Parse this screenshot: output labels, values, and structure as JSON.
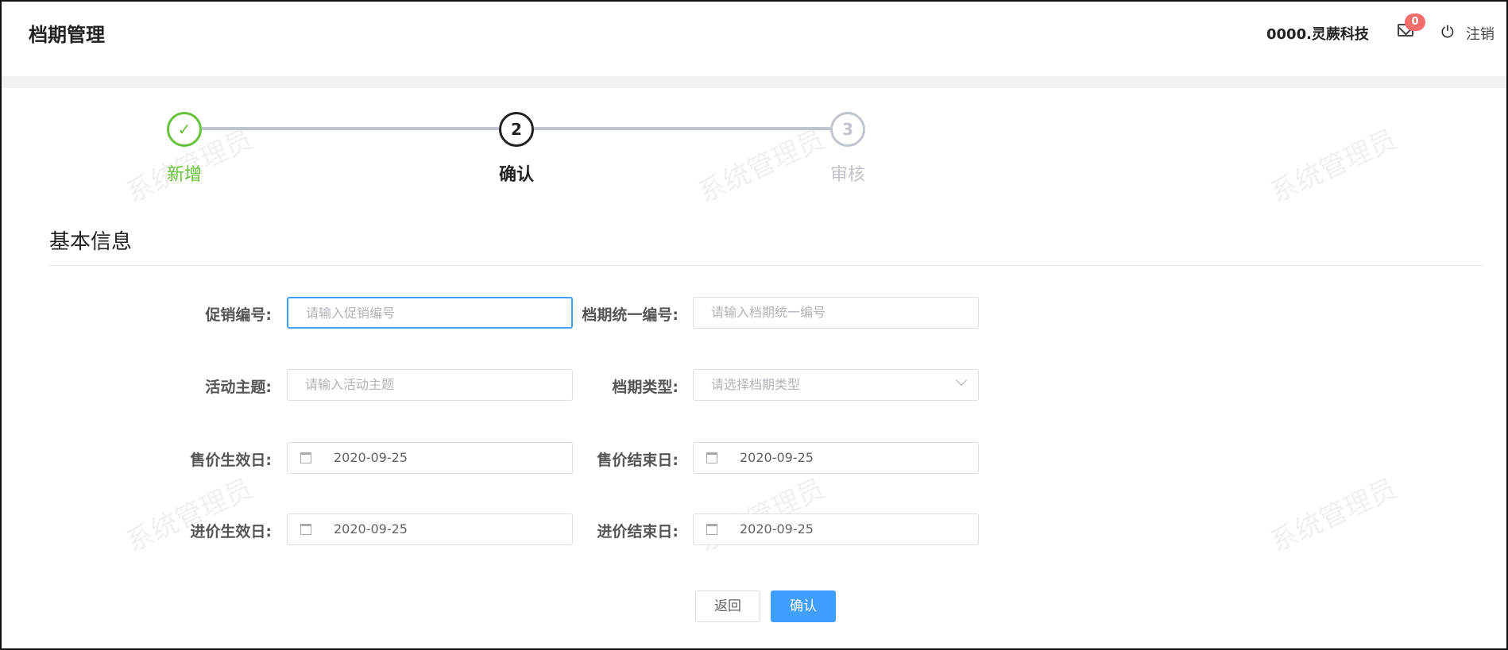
{
  "header": {
    "title": "档期管理",
    "company": "0000.灵蕨科技",
    "mail_count": "0",
    "logout": "注销"
  },
  "steps": [
    {
      "num": "1",
      "label": "新增",
      "status": "done"
    },
    {
      "num": "2",
      "label": "确认",
      "status": "active"
    },
    {
      "num": "3",
      "label": "审核",
      "status": "wait"
    }
  ],
  "section_title": "基本信息",
  "form": {
    "promo_no": {
      "label": "促销编号:",
      "placeholder": "请输入促销编号"
    },
    "schedule_no": {
      "label": "档期统一编号:",
      "placeholder": "请输入档期统一编号"
    },
    "theme": {
      "label": "活动主题:",
      "placeholder": "请输入活动主题"
    },
    "schedule_type": {
      "label": "档期类型:",
      "placeholder": "请选择档期类型"
    },
    "sale_start": {
      "label": "售价生效日:",
      "value": "2020-09-25"
    },
    "sale_end": {
      "label": "售价结束日:",
      "value": "2020-09-25"
    },
    "purchase_start": {
      "label": "进价生效日:",
      "value": "2020-09-25"
    },
    "purchase_end": {
      "label": "进价结束日:",
      "value": "2020-09-25"
    }
  },
  "buttons": {
    "back": "返回",
    "confirm": "确认"
  },
  "watermark": "系统管理员",
  "colors": {
    "primary": "#409eff",
    "success": "#67c23a",
    "badge": "#f56c6c"
  }
}
